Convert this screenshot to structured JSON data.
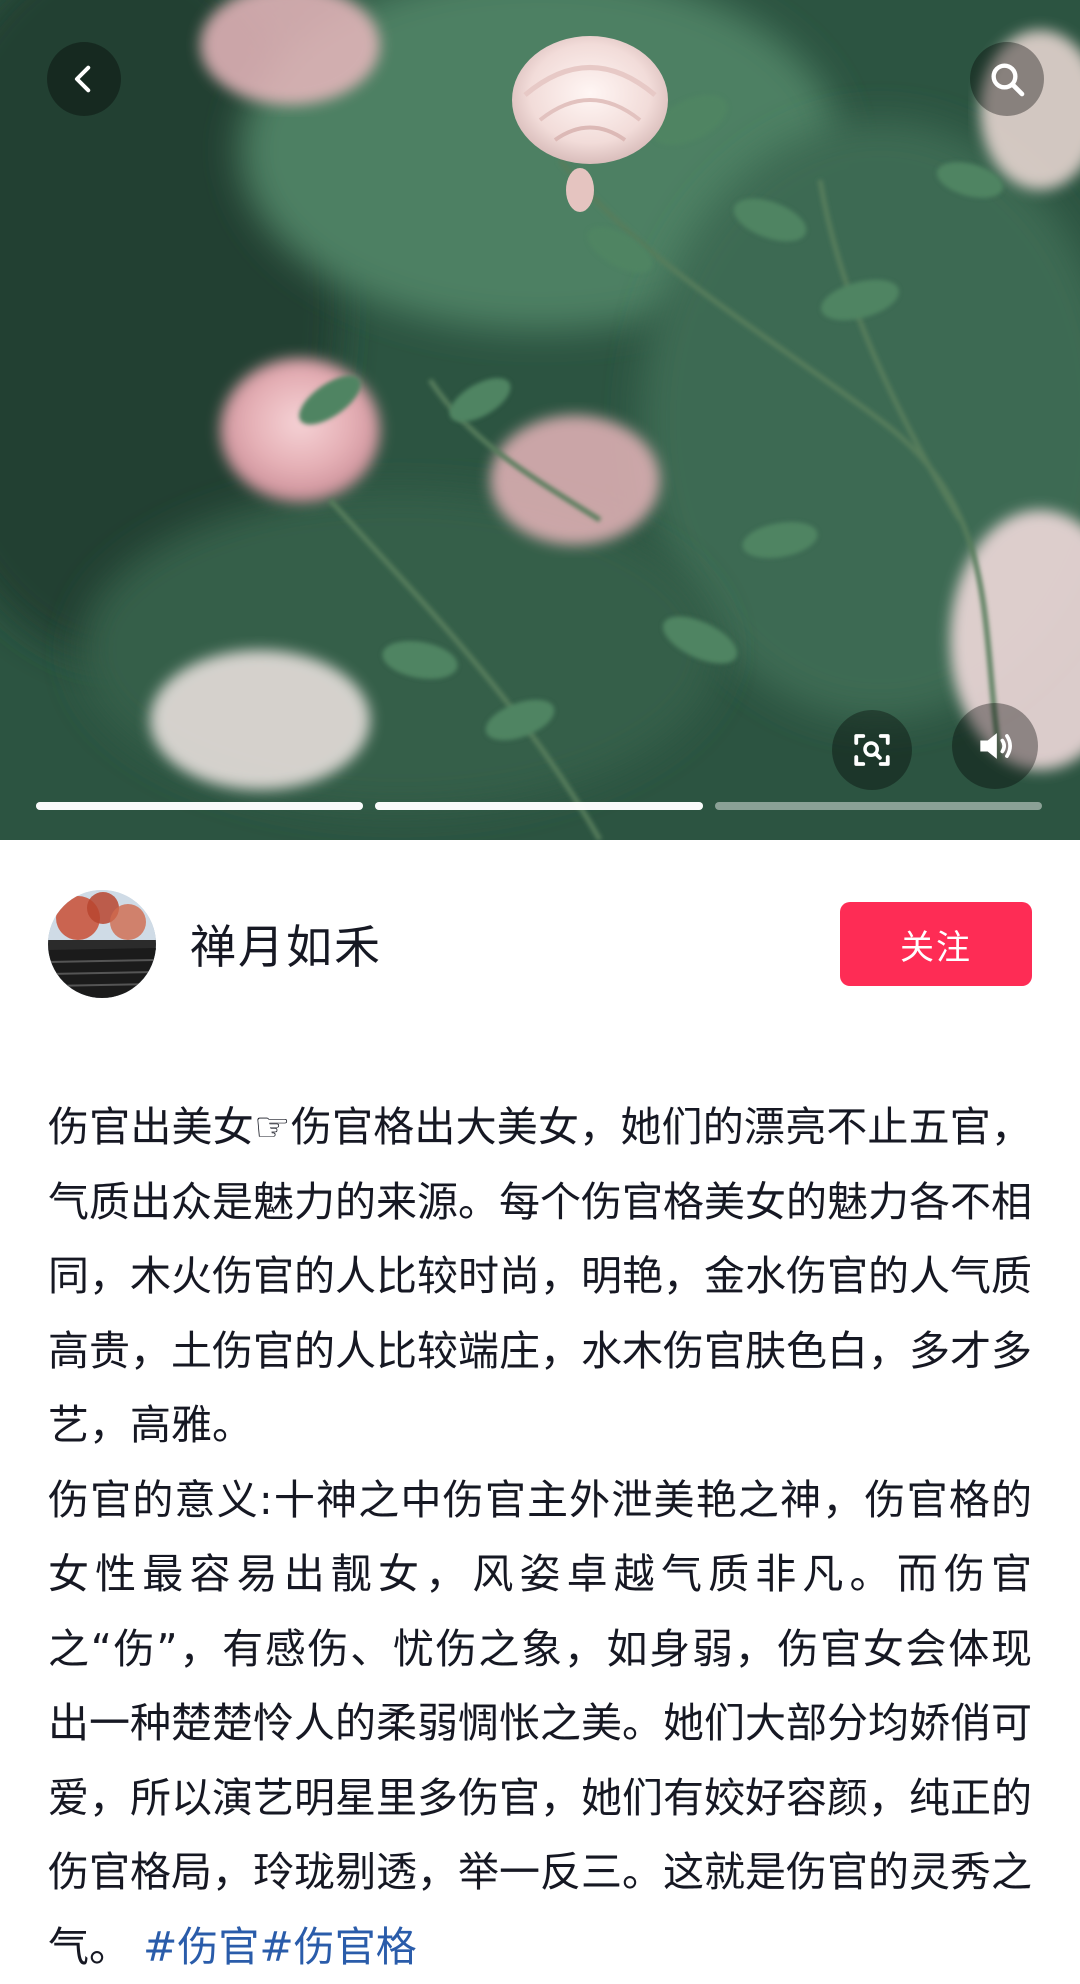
{
  "top_bar": {
    "back_icon": "chevron-left-icon",
    "search_icon": "search-icon"
  },
  "media": {
    "description_icons": [
      "image-search-icon",
      "volume-icon"
    ],
    "carousel_progress": [
      1.0,
      1.0,
      0.0
    ],
    "colors": {
      "overlay": "#00000059",
      "progress_active": "#ffffff"
    }
  },
  "author": {
    "name": "禅月如禾",
    "follow_label": "关注"
  },
  "post": {
    "paragraph1": "伤官出美女☞伤官格出大美女，她们的漂亮不止五官，气质出众是魅力的来源。每个伤官格美女的魅力各不相同，木火伤官的人比较时尚，明艳，金水伤官的人气质高贵，土伤官的人比较端庄，水木伤官肤色白，多才多艺，高雅。",
    "paragraph2": "伤官的意义:十神之中伤官主外泄美艳之神，伤官格的女性最容易出靓女，风姿卓越气质非凡。而伤官之“伤”，有感伤、忧伤之象，如身弱，伤官女会体现出一种楚楚怜人的柔弱惆怅之美。她们大部分均娇俏可爱，所以演艺明星里多伤官，她们有姣好容颜，纯正的伤官格局，玲珑剔透，举一反三。这就是伤官的灵秀之气。",
    "hashtags": [
      "#伤官",
      "#伤官格"
    ]
  },
  "colors": {
    "follow_button": "#fe2c55",
    "hashtag": "#2a5caa",
    "text": "#161823"
  }
}
